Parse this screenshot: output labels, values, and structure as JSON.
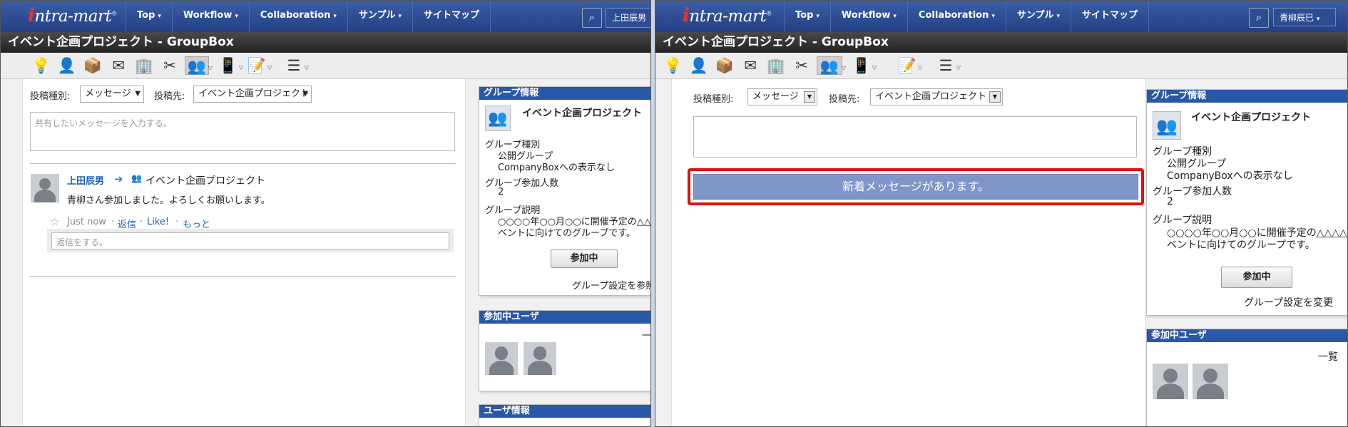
{
  "app": {
    "logo": "intra-mart",
    "logo_i": "i",
    "logo_rest": "ntra-mart",
    "reg": "®"
  },
  "nav": {
    "items": [
      {
        "label": "Top",
        "caret": "▾"
      },
      {
        "label": "Workflow",
        "caret": "▾"
      },
      {
        "label": "Collaboration",
        "caret": "▾"
      },
      {
        "label": "サンプル",
        "caret": "▾"
      },
      {
        "label": "サイトマップ",
        "caret": ""
      }
    ],
    "search_icon": "⌕"
  },
  "left": {
    "user": "上田辰男",
    "page_title": "イベント企画プロジェクト - GroupBox",
    "post_type_label": "投稿種別:",
    "post_type_value": "メッセージ",
    "post_to_label": "投稿先:",
    "post_to_value": "イベント企画プロジェクト",
    "message_placeholder": "共有したいメッセージを入力する。",
    "post": {
      "author": "上田辰男",
      "arrow": "➜",
      "target": "イベント企画プロジェクト",
      "body": "青柳さん参加しました。よろしくお願いします。",
      "star": "☆",
      "time": "Just now",
      "sep": "·",
      "reply": "返信",
      "like": "Like!",
      "more": "もっと",
      "reply_placeholder": "返信をする。"
    },
    "group_info": {
      "header": "グループ情報",
      "name": "イベント企画プロジェクト",
      "type_label": "グループ種別",
      "type_public": "公開グループ",
      "type_companybox": "CompanyBoxへの表示なし",
      "members_label": "グループ参加人数",
      "members_count": "2",
      "desc_label": "グループ説明",
      "desc_line1": "○○○○年○○月○○に開催予定の△△△イ",
      "desc_line2": "ベントに向けてのグループです。",
      "join_button": "参加中",
      "settings_link": "グループ設定を参照"
    },
    "members_panel": {
      "header": "参加中ユーザ",
      "list_link": "一覧"
    },
    "user_panel": {
      "header": "ユーザ情報"
    }
  },
  "right": {
    "user": "青柳辰巳",
    "page_title": "イベント企画プロジェクト - GroupBox",
    "post_type_label": "投稿種別:",
    "post_type_value": "メッセージ",
    "post_to_label": "投稿先:",
    "post_to_value": "イベント企画プロジェクト",
    "message_placeholder": "",
    "new_message_banner": "新着メッセージがあります。",
    "group_info": {
      "header": "グループ情報",
      "name": "イベント企画プロジェクト",
      "type_label": "グループ種別",
      "type_public": "公開グループ",
      "type_companybox": "CompanyBoxへの表示なし",
      "members_label": "グループ参加人数",
      "members_count": "2",
      "desc_label": "グループ説明",
      "desc_line1": "○○○○年○○月○○に開催予定の△△△△イ",
      "desc_line2": "ベントに向けてのグループです。",
      "join_button": "参加中",
      "settings_link": "グループ設定を変更"
    },
    "members_panel": {
      "header": "参加中ユーザ",
      "list_link": "一覧"
    }
  },
  "toolbar_icons": [
    "lightbulb-icon",
    "user-icon",
    "box-icon",
    "mail-icon",
    "building-icon",
    "tools-icon",
    "group-icon",
    "phone-icon",
    "document-edit-icon",
    "list-icon"
  ],
  "colors": {
    "nav": "#2d4c92",
    "title_bar": "#333333",
    "panel_header": "#2a58a8",
    "banner": "#8096c9",
    "highlight": "#dd1111",
    "link": "#1f5fbf"
  }
}
